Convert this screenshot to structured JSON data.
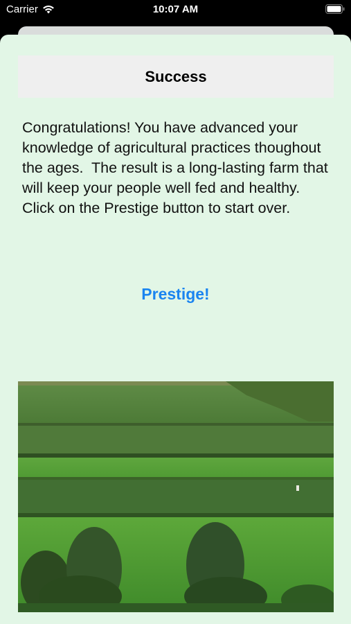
{
  "status_bar": {
    "carrier": "Carrier",
    "time": "10:07 AM"
  },
  "sheet": {
    "title": "Success",
    "message": "Congratulations! You have advanced your knowledge of agricultural practices thoughout the ages.  The result is a long-lasting farm that will keep your people well fed and healthy. Click on the Prestige button to start over.",
    "prestige_label": "Prestige!"
  },
  "colors": {
    "sheet_background": "#e2f6e6",
    "title_bar_background": "#efefef",
    "accent": "#1a84f0"
  },
  "icons": {
    "wifi": "wifi-icon",
    "battery": "battery-icon"
  }
}
